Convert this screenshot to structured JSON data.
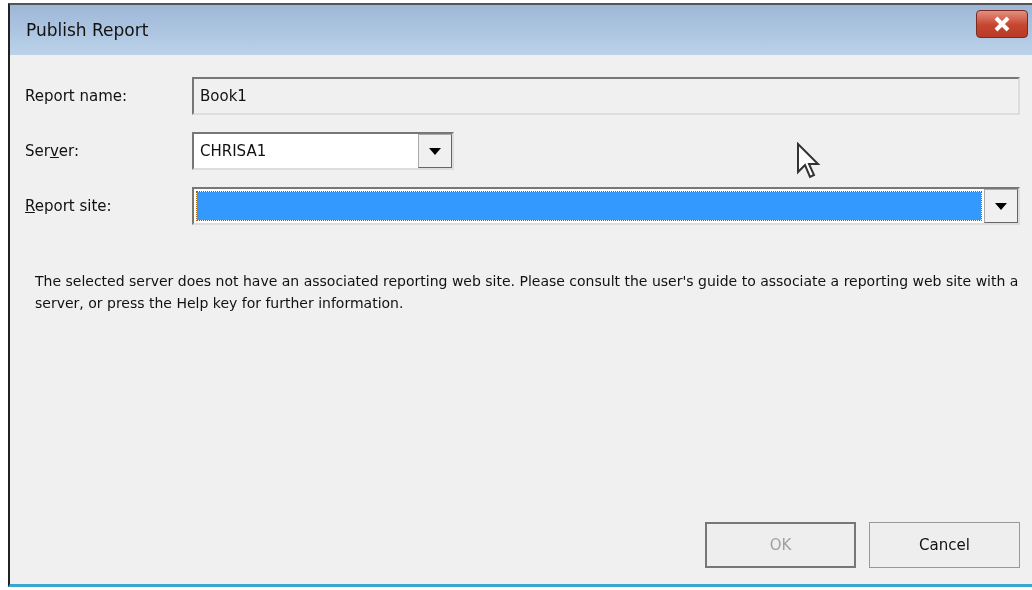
{
  "window": {
    "title": "Publish Report"
  },
  "fields": [
    {
      "kind": "text",
      "label": {
        "before": "Report name:"
      },
      "value": "Book1",
      "disabled": true,
      "wide": true,
      "highlighted": false
    },
    {
      "kind": "combo",
      "label": {
        "before": "Ser",
        "key": "v",
        "after": "er:"
      },
      "value": "CHRISA1",
      "disabled": false,
      "wide": false,
      "highlighted": false
    },
    {
      "kind": "combo",
      "label": {
        "key": "R",
        "after": "eport site:"
      },
      "disabled": false,
      "wide": true,
      "highlighted": true
    }
  ],
  "message": "The selected server does not have an associated reporting web site. Please consult the user's guide to associate a reporting web site with a server, or press the Help key for further information.",
  "buttons": [
    {
      "label": "OK",
      "disabled": true
    },
    {
      "label": "Cancel",
      "disabled": false
    }
  ]
}
